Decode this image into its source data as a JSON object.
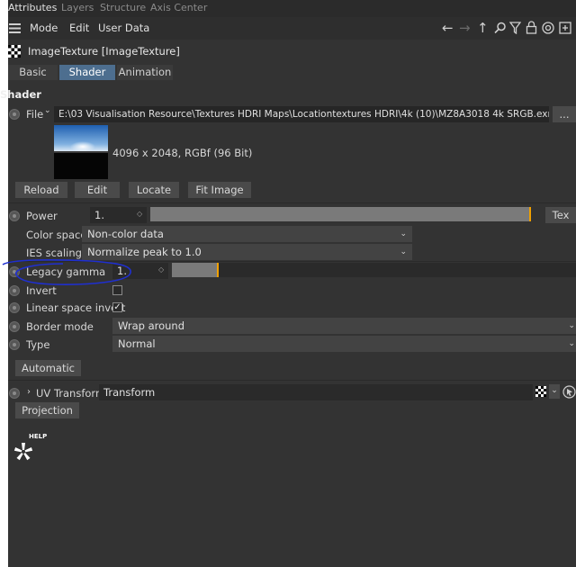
{
  "tabs": [
    "Attributes",
    "Layers",
    "Structure",
    "Axis Center"
  ],
  "menu": [
    "Mode",
    "Edit",
    "User Data"
  ],
  "object_title": "ImageTexture [ImageTexture]",
  "mode_tabs": [
    "Basic",
    "Shader",
    "Animation"
  ],
  "section_title": "Shader",
  "file": {
    "label": "File",
    "path": "E:\\03 Visualisation Resource\\Textures HDRI Maps\\Locationtextures HDRI\\4k (10)\\MZ8A3018 4k SRGB.exr",
    "browse_label": "...",
    "info": "4096 x 2048, RGBf (96 Bit)"
  },
  "file_buttons": [
    "Reload",
    "Edit",
    "Locate",
    "Fit Image"
  ],
  "power": {
    "label": "Power",
    "value": "1.",
    "slider_fraction": 1.0,
    "tex_label": "Tex"
  },
  "color_space": {
    "label": "Color space",
    "value": "Non-color data"
  },
  "ies_scaling": {
    "label": "IES scaling",
    "value": "Normalize peak to 1.0"
  },
  "legacy_gamma": {
    "label": "Legacy gamma",
    "value": "1.",
    "slider_fraction": 0.1
  },
  "invert": {
    "label": "Invert",
    "checked": false
  },
  "linear_space_invert": {
    "label": "Linear space invert",
    "checked": true
  },
  "border_mode": {
    "label": "Border mode",
    "value": "Wrap around"
  },
  "type": {
    "label": "Type",
    "value": "Normal"
  },
  "automatic_label": "Automatic",
  "uv_transform": {
    "label": "UV Transform",
    "value": "Transform"
  },
  "projection_label": "Projection",
  "help_label": "HELP",
  "colors": {
    "panel_bg": "#333333",
    "accent_tab": "#4d6e8f",
    "slider_knob": "#f0a000",
    "annotation": "#1f2fd0"
  },
  "icons": [
    "hamburger-icon",
    "back-arrow-icon",
    "forward-arrow-icon",
    "up-arrow-icon",
    "search-icon",
    "filter-icon",
    "lock-icon",
    "target-icon",
    "new-window-icon",
    "checker-texture-icon",
    "help-octane-icon"
  ]
}
